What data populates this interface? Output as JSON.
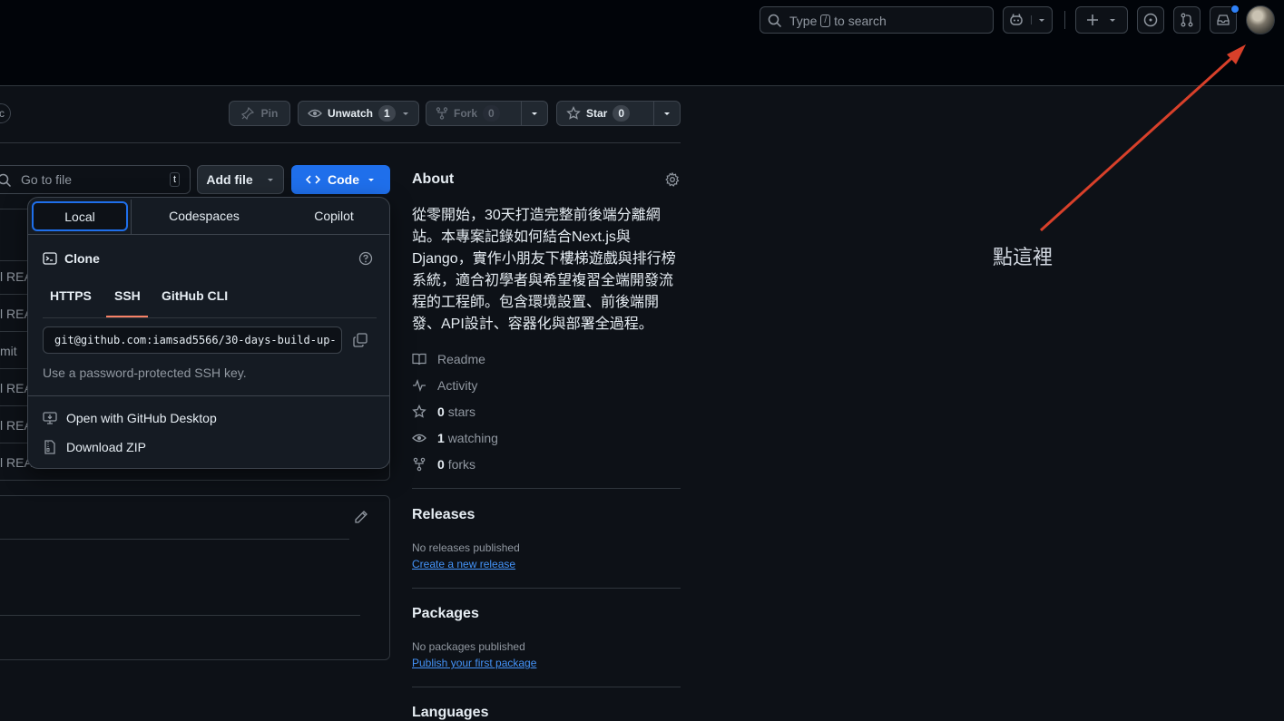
{
  "header": {
    "search_placeholder": "to search",
    "search_prefix": "Type",
    "search_key": "/"
  },
  "repo_actions": {
    "partial_badge": "c",
    "pin": "Pin",
    "unwatch": "Unwatch",
    "unwatch_count": "1",
    "fork": "Fork",
    "fork_count": "0",
    "star": "Star",
    "star_count": "0"
  },
  "files": {
    "goto_placeholder": "Go to file",
    "goto_key": "t",
    "add_file": "Add file",
    "code": "Code",
    "row_fragments": [
      "l REA",
      "l REA",
      "mit",
      "l REA",
      "l REA",
      "l REA"
    ]
  },
  "code_dropdown": {
    "tabs": [
      "Local",
      "Codespaces",
      "Copilot"
    ],
    "clone_title": "Clone",
    "protocols": [
      "HTTPS",
      "SSH",
      "GitHub CLI"
    ],
    "active_protocol": "SSH",
    "clone_url": "git@github.com:iamsad5566/30-days-build-up-",
    "ssh_hint": "Use a password-protected SSH key.",
    "open_desktop": "Open with GitHub Desktop",
    "download_zip": "Download ZIP"
  },
  "about": {
    "title": "About",
    "description": "從零開始，30天打造完整前後端分離網站。本專案記錄如何結合Next.js與Django，實作小朋友下樓梯遊戲與排行榜系統，適合初學者與希望複習全端開發流程的工程師。包含環境設置、前後端開發、API設計、容器化與部署全過程。",
    "readme": "Readme",
    "activity": "Activity",
    "stars_count": "0",
    "stars_label": "stars",
    "watching_count": "1",
    "watching_label": "watching",
    "forks_count": "0",
    "forks_label": "forks"
  },
  "releases": {
    "title": "Releases",
    "none": "No releases published",
    "create": "Create a new release"
  },
  "packages": {
    "title": "Packages",
    "none": "No packages published",
    "publish": "Publish your first package"
  },
  "languages": {
    "title": "Languages"
  },
  "annotation": {
    "text": "點這裡",
    "color": "#d8402a"
  },
  "colors": {
    "accent": "#1f6feb",
    "background": "#0d1117",
    "header": "#010409"
  }
}
